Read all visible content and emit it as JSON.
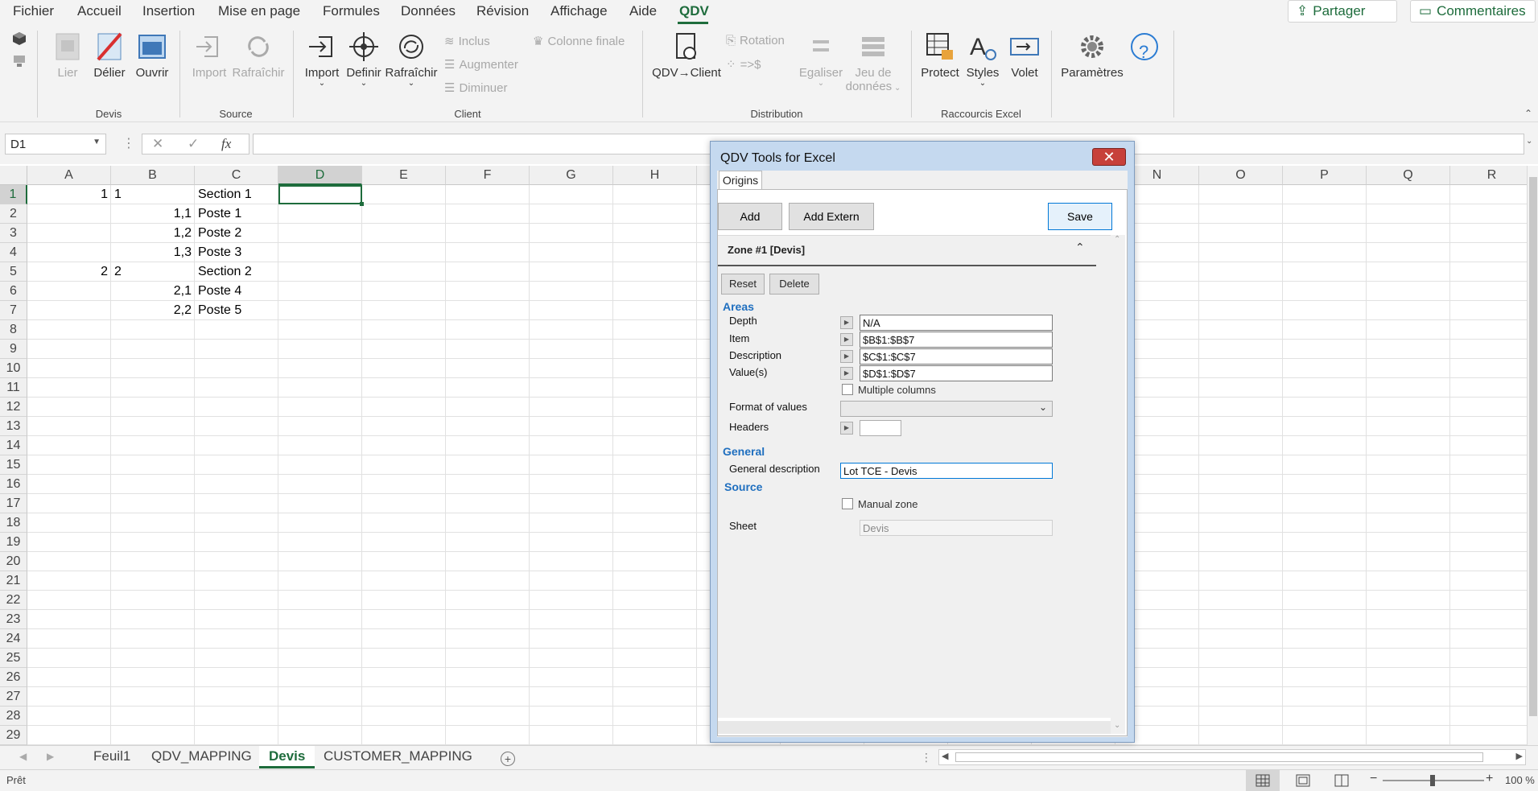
{
  "menu": {
    "items": [
      "Fichier",
      "Accueil",
      "Insertion",
      "Mise en page",
      "Formules",
      "Données",
      "Révision",
      "Affichage",
      "Aide",
      "QDV"
    ],
    "share_label": "Partager",
    "comments_label": "Commentaires"
  },
  "ribbon": {
    "devis": {
      "label": "Devis",
      "lier": "Lier",
      "delier": "Délier",
      "ouvrir": "Ouvrir"
    },
    "source": {
      "label": "Source",
      "import": "Import",
      "rafraichir": "Rafraîchir"
    },
    "client": {
      "label": "Client",
      "import": "Import",
      "definir": "Definir",
      "rafraichir": "Rafraîchir",
      "inclus": "Inclus",
      "augmenter": "Augmenter",
      "diminuer": "Diminuer",
      "colonne_finale": "Colonne finale"
    },
    "distribution": {
      "label": "Distribution",
      "qdv_client": "QDV→Client",
      "rotation": "Rotation",
      "to_dollar": "=>$",
      "egaliser": "Egaliser",
      "jeu_de": "Jeu de",
      "donnees": "données"
    },
    "raccourcis": {
      "label": "Raccourcis Excel",
      "protect": "Protect",
      "styles": "Styles",
      "volet": "Volet"
    },
    "parametres": "Paramètres",
    "help_glyph": "?"
  },
  "formula": {
    "namebox": "D1",
    "fx": "fx",
    "cancel": "✕",
    "enter": "✓"
  },
  "grid": {
    "columns_left": [
      "A",
      "B",
      "C",
      "D",
      "E",
      "F",
      "G",
      "H"
    ],
    "columns_right": [
      "N",
      "O",
      "P",
      "Q",
      "R"
    ],
    "rows": [
      "1",
      "2",
      "3",
      "4",
      "5",
      "6",
      "7",
      "8",
      "9",
      "10",
      "11",
      "12",
      "13",
      "14",
      "15",
      "16",
      "17",
      "18",
      "19",
      "20",
      "21",
      "22",
      "23",
      "24",
      "25",
      "26",
      "27",
      "28",
      "29"
    ],
    "cells": [
      {
        "a": "1",
        "b": "1",
        "bb": "",
        "c": "Section 1"
      },
      {
        "a": "",
        "b": "",
        "bb": "1,1",
        "c": "Poste 1"
      },
      {
        "a": "",
        "b": "",
        "bb": "1,2",
        "c": "Poste 2"
      },
      {
        "a": "",
        "b": "",
        "bb": "1,3",
        "c": "Poste 3"
      },
      {
        "a": "2",
        "b": "2",
        "bb": "",
        "c": "Section 2"
      },
      {
        "a": "",
        "b": "",
        "bb": "2,1",
        "c": "Poste 4"
      },
      {
        "a": "",
        "b": "",
        "bb": "2,2",
        "c": "Poste 5"
      }
    ]
  },
  "sheets": {
    "tabs": [
      "Feuil1",
      "QDV_MAPPING",
      "Devis",
      "CUSTOMER_MAPPING"
    ],
    "active": "Devis"
  },
  "status": {
    "ready": "Prêt",
    "zoom": "100 %"
  },
  "dialog": {
    "title": "QDV Tools for Excel",
    "close": "✕",
    "tab": "Origins",
    "add": "Add",
    "add_extern": "Add Extern",
    "save": "Save",
    "zone_header": "Zone #1 [Devis]",
    "reset": "Reset",
    "delete": "Delete",
    "areas": "Areas",
    "depth_label": "Depth",
    "depth_value": "N/A",
    "item_label": "Item",
    "item_value": "$B$1:$B$7",
    "description_label": "Description",
    "description_value": "$C$1:$C$7",
    "values_label": "Value(s)",
    "values_value": "$D$1:$D$7",
    "multiple_columns": "Multiple columns",
    "format_label": "Format of values",
    "format_value": "",
    "headers_label": "Headers",
    "headers_value": "",
    "general": "General",
    "general_desc_label": "General description",
    "general_desc_value": "Lot TCE - Devis",
    "source": "Source",
    "manual_zone": "Manual zone",
    "sheet_label": "Sheet",
    "sheet_value": "Devis"
  }
}
